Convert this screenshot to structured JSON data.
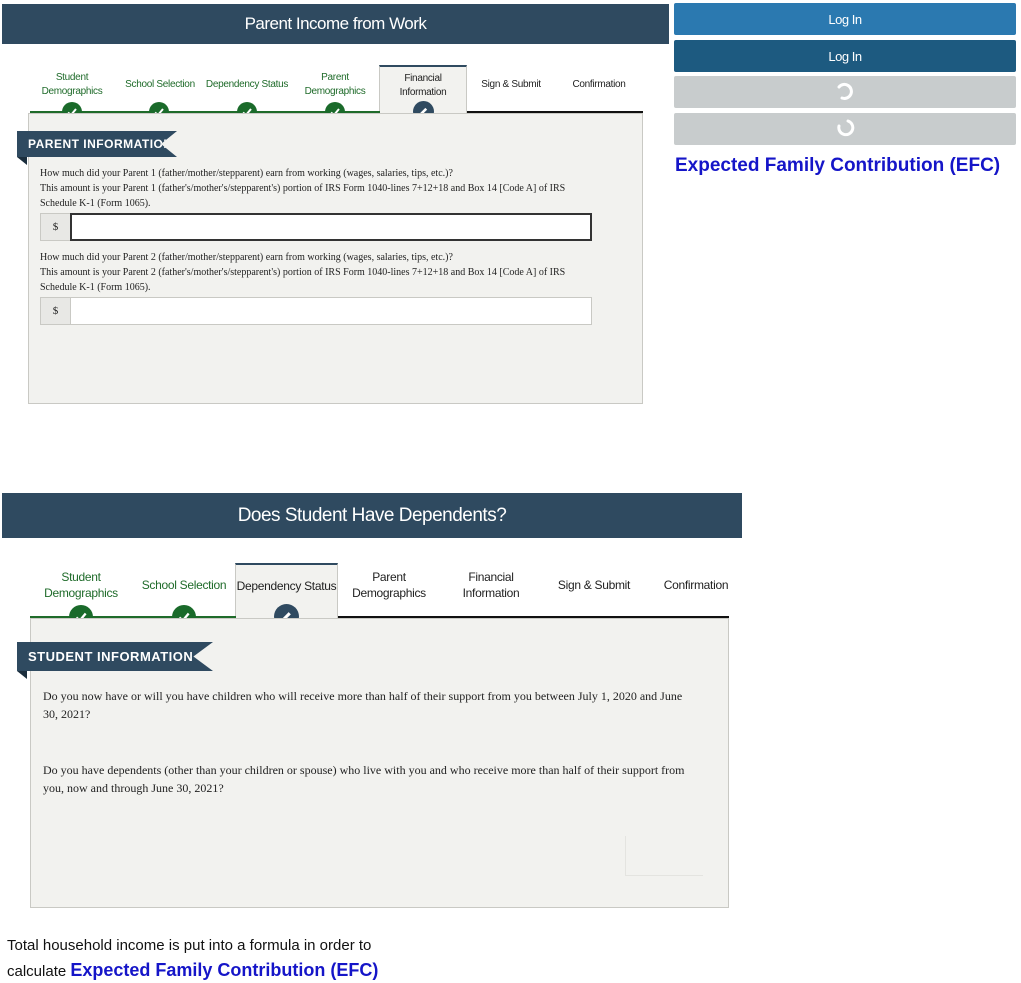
{
  "top_panel": {
    "title": "Parent Income from Work",
    "steps": [
      {
        "label": "Student Demographics",
        "state": "done"
      },
      {
        "label": "School Selection",
        "state": "done"
      },
      {
        "label": "Dependency Status",
        "state": "done"
      },
      {
        "label": "Parent Demographics",
        "state": "done"
      },
      {
        "label": "Financial Information",
        "state": "current"
      },
      {
        "label": "Sign & Submit",
        "state": "future"
      },
      {
        "label": "Confirmation",
        "state": "future"
      }
    ],
    "section_title": "PARENT INFORMATION",
    "question1": "How much did your Parent 1 (father/mother/stepparent) earn from working (wages, salaries, tips, etc.)?",
    "question1_detail": "This amount is your Parent 1 (father's/mother's/stepparent's) portion of IRS Form 1040-lines 7+12+18 and Box 14 [Code A] of IRS Schedule K-1 (Form 1065).",
    "question2": "How much did your Parent 2 (father/mother/stepparent) earn from working (wages, salaries, tips, etc.)?",
    "question2_detail": "This amount is your Parent 2 (father's/mother's/stepparent's) portion of IRS Form 1040-lines 7+12+18 and Box 14 [Code A] of IRS Schedule K-1 (Form 1065).",
    "currency_symbol": "$",
    "parent1_value": "",
    "parent2_value": ""
  },
  "buttons": {
    "login1": "Log In",
    "login2": "Log In"
  },
  "efc_label_right": "Expected Family Contribution (EFC)",
  "bottom_panel": {
    "title": "Does Student Have Dependents?",
    "steps": [
      {
        "label": "Student Demographics",
        "state": "done"
      },
      {
        "label": "School Selection",
        "state": "done"
      },
      {
        "label": "Dependency Status",
        "state": "current"
      },
      {
        "label": "Parent Demographics",
        "state": "future"
      },
      {
        "label": "Financial Information",
        "state": "future"
      },
      {
        "label": "Sign & Submit",
        "state": "future"
      },
      {
        "label": "Confirmation",
        "state": "future"
      }
    ],
    "section_title": "STUDENT INFORMATION",
    "question1": "Do you now have or will you have children who will receive more than half of their support from you between July 1, 2020 and June 30, 2021?",
    "question2": "Do you have dependents (other than your children or spouse) who live with you and who receive more than half of their support from you, now and through June 30, 2021?"
  },
  "caption": {
    "line1": "Total household income is put into a formula in order to",
    "line2_prefix": "calculate",
    "line2_emphasis": "Expected Family Contribution (EFC)"
  },
  "colors": {
    "titlebar": "#2f4a60",
    "done_green": "#1a6a2a",
    "login_blue": "#2b79b0",
    "login_navy": "#1d5a80",
    "loading_grey": "#c8cccd",
    "efc_blue": "#1515c8"
  },
  "icons": {
    "done_step": "check-circle-icon",
    "current_step": "pencil-icon",
    "loading": "spinner-icon"
  }
}
